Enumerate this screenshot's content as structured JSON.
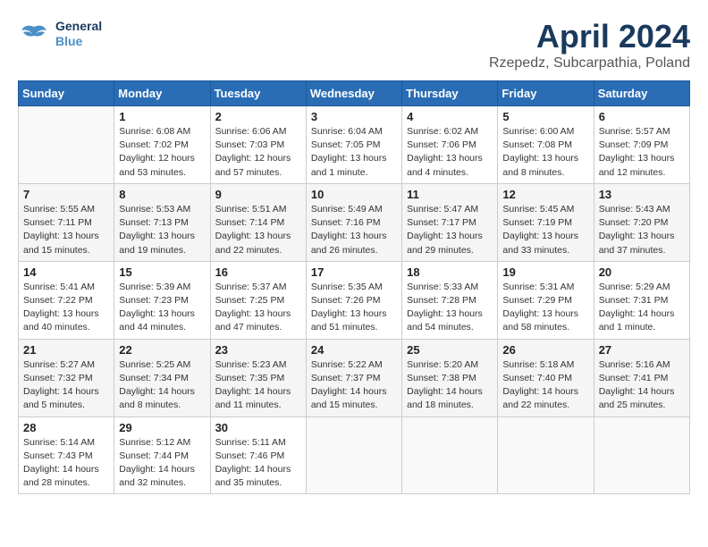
{
  "logo": {
    "line1": "General",
    "line2": "Blue"
  },
  "title": "April 2024",
  "subtitle": "Rzepedz, Subcarpathia, Poland",
  "days_of_week": [
    "Sunday",
    "Monday",
    "Tuesday",
    "Wednesday",
    "Thursday",
    "Friday",
    "Saturday"
  ],
  "weeks": [
    [
      {
        "day": null,
        "info": null
      },
      {
        "day": "1",
        "info": "Sunrise: 6:08 AM\nSunset: 7:02 PM\nDaylight: 12 hours\nand 53 minutes."
      },
      {
        "day": "2",
        "info": "Sunrise: 6:06 AM\nSunset: 7:03 PM\nDaylight: 12 hours\nand 57 minutes."
      },
      {
        "day": "3",
        "info": "Sunrise: 6:04 AM\nSunset: 7:05 PM\nDaylight: 13 hours\nand 1 minute."
      },
      {
        "day": "4",
        "info": "Sunrise: 6:02 AM\nSunset: 7:06 PM\nDaylight: 13 hours\nand 4 minutes."
      },
      {
        "day": "5",
        "info": "Sunrise: 6:00 AM\nSunset: 7:08 PM\nDaylight: 13 hours\nand 8 minutes."
      },
      {
        "day": "6",
        "info": "Sunrise: 5:57 AM\nSunset: 7:09 PM\nDaylight: 13 hours\nand 12 minutes."
      }
    ],
    [
      {
        "day": "7",
        "info": "Sunrise: 5:55 AM\nSunset: 7:11 PM\nDaylight: 13 hours\nand 15 minutes."
      },
      {
        "day": "8",
        "info": "Sunrise: 5:53 AM\nSunset: 7:13 PM\nDaylight: 13 hours\nand 19 minutes."
      },
      {
        "day": "9",
        "info": "Sunrise: 5:51 AM\nSunset: 7:14 PM\nDaylight: 13 hours\nand 22 minutes."
      },
      {
        "day": "10",
        "info": "Sunrise: 5:49 AM\nSunset: 7:16 PM\nDaylight: 13 hours\nand 26 minutes."
      },
      {
        "day": "11",
        "info": "Sunrise: 5:47 AM\nSunset: 7:17 PM\nDaylight: 13 hours\nand 29 minutes."
      },
      {
        "day": "12",
        "info": "Sunrise: 5:45 AM\nSunset: 7:19 PM\nDaylight: 13 hours\nand 33 minutes."
      },
      {
        "day": "13",
        "info": "Sunrise: 5:43 AM\nSunset: 7:20 PM\nDaylight: 13 hours\nand 37 minutes."
      }
    ],
    [
      {
        "day": "14",
        "info": "Sunrise: 5:41 AM\nSunset: 7:22 PM\nDaylight: 13 hours\nand 40 minutes."
      },
      {
        "day": "15",
        "info": "Sunrise: 5:39 AM\nSunset: 7:23 PM\nDaylight: 13 hours\nand 44 minutes."
      },
      {
        "day": "16",
        "info": "Sunrise: 5:37 AM\nSunset: 7:25 PM\nDaylight: 13 hours\nand 47 minutes."
      },
      {
        "day": "17",
        "info": "Sunrise: 5:35 AM\nSunset: 7:26 PM\nDaylight: 13 hours\nand 51 minutes."
      },
      {
        "day": "18",
        "info": "Sunrise: 5:33 AM\nSunset: 7:28 PM\nDaylight: 13 hours\nand 54 minutes."
      },
      {
        "day": "19",
        "info": "Sunrise: 5:31 AM\nSunset: 7:29 PM\nDaylight: 13 hours\nand 58 minutes."
      },
      {
        "day": "20",
        "info": "Sunrise: 5:29 AM\nSunset: 7:31 PM\nDaylight: 14 hours\nand 1 minute."
      }
    ],
    [
      {
        "day": "21",
        "info": "Sunrise: 5:27 AM\nSunset: 7:32 PM\nDaylight: 14 hours\nand 5 minutes."
      },
      {
        "day": "22",
        "info": "Sunrise: 5:25 AM\nSunset: 7:34 PM\nDaylight: 14 hours\nand 8 minutes."
      },
      {
        "day": "23",
        "info": "Sunrise: 5:23 AM\nSunset: 7:35 PM\nDaylight: 14 hours\nand 11 minutes."
      },
      {
        "day": "24",
        "info": "Sunrise: 5:22 AM\nSunset: 7:37 PM\nDaylight: 14 hours\nand 15 minutes."
      },
      {
        "day": "25",
        "info": "Sunrise: 5:20 AM\nSunset: 7:38 PM\nDaylight: 14 hours\nand 18 minutes."
      },
      {
        "day": "26",
        "info": "Sunrise: 5:18 AM\nSunset: 7:40 PM\nDaylight: 14 hours\nand 22 minutes."
      },
      {
        "day": "27",
        "info": "Sunrise: 5:16 AM\nSunset: 7:41 PM\nDaylight: 14 hours\nand 25 minutes."
      }
    ],
    [
      {
        "day": "28",
        "info": "Sunrise: 5:14 AM\nSunset: 7:43 PM\nDaylight: 14 hours\nand 28 minutes."
      },
      {
        "day": "29",
        "info": "Sunrise: 5:12 AM\nSunset: 7:44 PM\nDaylight: 14 hours\nand 32 minutes."
      },
      {
        "day": "30",
        "info": "Sunrise: 5:11 AM\nSunset: 7:46 PM\nDaylight: 14 hours\nand 35 minutes."
      },
      {
        "day": null,
        "info": null
      },
      {
        "day": null,
        "info": null
      },
      {
        "day": null,
        "info": null
      },
      {
        "day": null,
        "info": null
      }
    ]
  ]
}
